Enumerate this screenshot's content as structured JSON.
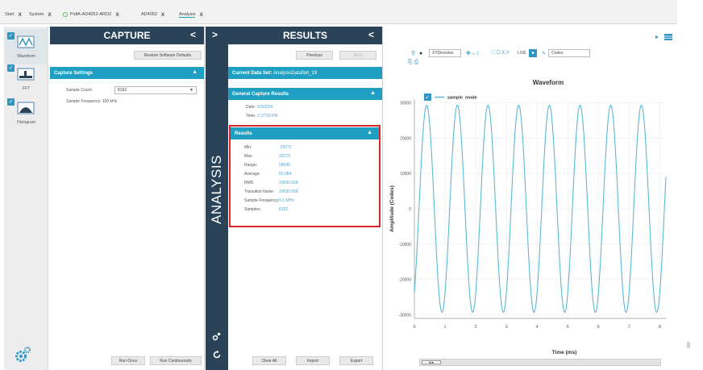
{
  "tabs": [
    {
      "label": "Start",
      "close": "X"
    },
    {
      "label": "System",
      "close": "X"
    },
    {
      "label": "PollA-AD4052-ARDZ",
      "close": "X",
      "status": "connected"
    },
    {
      "label": "AD4052",
      "close": "X"
    },
    {
      "label": "Analysis",
      "close": "X",
      "active": true
    }
  ],
  "nav": [
    {
      "label": "Waveform",
      "selected": true,
      "icon": "waveform-icon"
    },
    {
      "label": "FFT",
      "icon": "fft-icon"
    },
    {
      "label": "Histogram",
      "icon": "histogram-icon"
    }
  ],
  "capture": {
    "title": "CAPTURE",
    "restore_label": "Restore Software Defaults",
    "settings_title": "Capture Settings",
    "sample_count_label": "Sample Count:",
    "sample_count_value": "8192",
    "sample_freq_label": "Sample Frequency: 100 kHz",
    "run_once_label": "Run Once",
    "run_cont_label": "Run Continuously"
  },
  "strip": {
    "label": "ANALYSIS"
  },
  "results": {
    "title": "RESULTS",
    "previous_label": "Previous",
    "next_label": "Next",
    "current_label": "Current Data Set:",
    "current_value": "AnalysisDataSet_19",
    "general_title": "General Capture Results",
    "date_label": "Date:",
    "date_value": "6/3/2024",
    "time_label": "Time:",
    "time_value": "2:37:50 PM",
    "results_title": "Results",
    "rows": [
      {
        "k": "Min:",
        "v": "-29272"
      },
      {
        "k": "Max:",
        "v": "29273"
      },
      {
        "k": "Range:",
        "v": "58545"
      },
      {
        "k": "Average:",
        "v": "50.984"
      },
      {
        "k": "RMS:",
        "v": "20690.568"
      },
      {
        "k": "Transition Noise:",
        "v": "20690.568"
      },
      {
        "k": "Sample Frequency:",
        "v": "0.1 MHz"
      },
      {
        "k": "Samples:",
        "v": "8192"
      }
    ],
    "clear_label": "Clear All",
    "import_label": "Import",
    "export_label": "Export"
  },
  "toolbar": {
    "direction_label": "XYDirection",
    "log_label": "LOG",
    "y_unit_label": "Codes",
    "x_unit_label": "Time (ms)"
  },
  "chart_data": {
    "type": "line",
    "title": "Waveform",
    "xlabel": "Time (ms)",
    "ylabel": "Amplitude (Codes)",
    "xlim": [
      0,
      8.2
    ],
    "ylim": [
      -31000,
      31000
    ],
    "xticks": [
      0,
      1,
      2,
      3,
      4,
      5,
      6,
      7,
      8
    ],
    "yticks": [
      30000,
      20000,
      10000,
      0,
      -10000,
      -20000,
      -30000
    ],
    "legend": "top-left",
    "grid": true,
    "series": [
      {
        "name": "sample_mode",
        "color": "#5bb8d4",
        "amplitude": 29273,
        "frequency_khz": 1,
        "phase_start_ms": 0.4
      }
    ]
  },
  "figure_code": "006"
}
